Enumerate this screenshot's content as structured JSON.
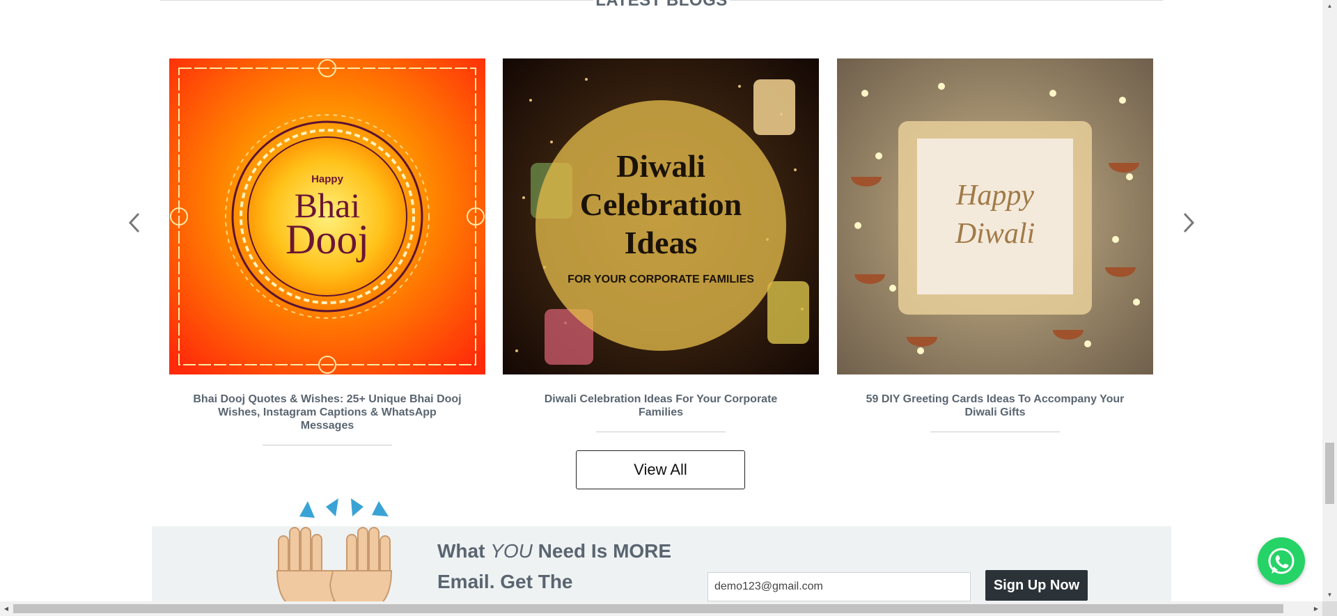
{
  "section": {
    "title": "LATEST BLOGS"
  },
  "carousel": {
    "prev_icon": "chevron-left-icon",
    "next_icon": "chevron-right-icon",
    "cards": [
      {
        "image_text": {
          "line1": "Happy",
          "line2": "Bhai",
          "line3": "Dooj"
        },
        "title": "Bhai Dooj Quotes & Wishes: 25+ Unique Bhai Dooj Wishes, Instagram Captions & WhatsApp Messages"
      },
      {
        "image_text": {
          "line1": "Diwali",
          "line2": "Celebration",
          "line3": "Ideas",
          "line4": "FOR YOUR CORPORATE FAMILIES"
        },
        "title": "Diwali Celebration Ideas For Your Corporate Families"
      },
      {
        "image_text": {
          "line1": "Happy",
          "line2": "Diwali"
        },
        "title": "59 DIY Greeting Cards Ideas To Accompany Your Diwali Gifts"
      }
    ]
  },
  "view_all": {
    "label": "View All"
  },
  "newsletter": {
    "headline_part1": "What ",
    "headline_emph": "YOU",
    "headline_part2": " Need Is MORE Email. Get The",
    "email_value": "demo123@gmail.com",
    "signup_label": "Sign Up Now"
  },
  "floating": {
    "whatsapp_icon": "whatsapp-icon"
  },
  "colors": {
    "accent_dark": "#2b3238",
    "text": "#5a6570",
    "whatsapp": "#25d366"
  }
}
